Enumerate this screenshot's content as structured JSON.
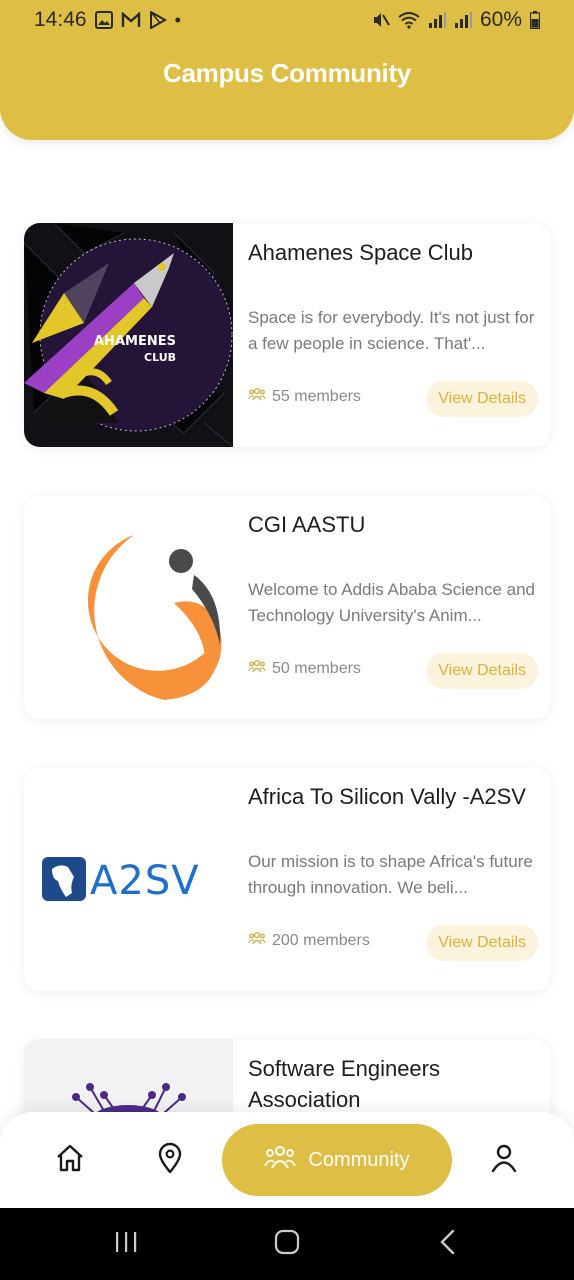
{
  "status_bar": {
    "time": "14:46",
    "battery": "60%"
  },
  "header": {
    "title": "Campus Community"
  },
  "clubs": [
    {
      "name": "Ahamenes Space Club",
      "description": "Space is for everybody. It's not just for a few people in science. That'...",
      "members": "55 members",
      "button": "View Details",
      "logo_text": [
        "AHAMENES",
        "CLUB"
      ]
    },
    {
      "name": "CGI AASTU",
      "description": "Welcome to Addis Ababa Science and Technology University's Anim...",
      "members": "50 members",
      "button": "View Details"
    },
    {
      "name": "Africa To Silicon Vally -A2SV",
      "description": "Our mission is to shape Africa's future through innovation. We beli...",
      "members": "200 members",
      "button": "View Details",
      "logo_text": "A2SV"
    },
    {
      "name": "Software Engineers Association"
    }
  ],
  "bottom_nav": {
    "active_label": "Community",
    "items": [
      "home-icon",
      "location-pin-icon",
      "community-icon",
      "profile-icon"
    ]
  },
  "colors": {
    "accent": "#dfbe45",
    "button_bg": "#fbf3dc",
    "button_text": "#d7b33e"
  }
}
